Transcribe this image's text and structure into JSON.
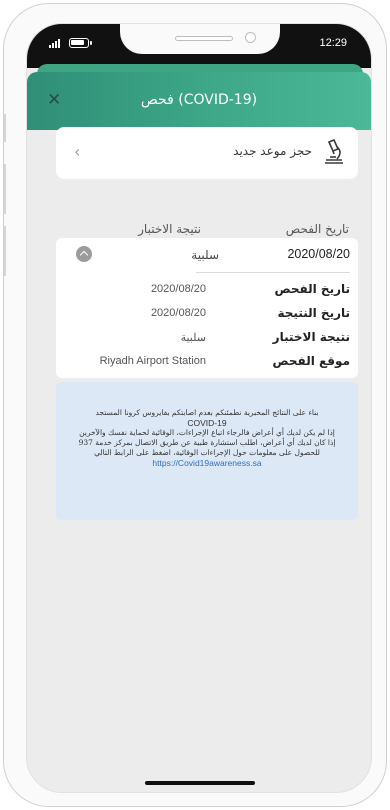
{
  "status_bar": {
    "time": "12:29",
    "signal_icon": "signal-icon",
    "battery_icon": "battery-icon"
  },
  "header": {
    "title": "فحص (COVID-19)",
    "close_icon": "close-icon"
  },
  "book": {
    "label": "حجز موعد جديد",
    "icon": "microscope-icon",
    "chevron": "chevron-left-icon"
  },
  "columns": {
    "date": "تاريخ الفحص",
    "result": "نتيجة الاختبار"
  },
  "summary": {
    "date": "2020/08/20",
    "result": "سلبية"
  },
  "details": [
    {
      "label": "تاريخ الفحص",
      "value": "2020/08/20"
    },
    {
      "label": "تاريخ النتيجة",
      "value": "2020/08/20"
    },
    {
      "label": "نتيجة الاختبار",
      "value": "سلبية"
    },
    {
      "label": "موقع الفحص",
      "value": "Riyadh Airport Station"
    }
  ],
  "info": {
    "line1": "بناء على النتائج المخبرية نطمئنكم بعدم اصابتكم بفايروس كرونا المستجد",
    "line1_en": "COVID-19",
    "line2": "إذا لم يكن لديك أي أعراض فالرجاء اتباع الإجراءات، الوقائية لحماية نفسك والآخرين",
    "line3": "إذا كان لديك أي أعراض، اطلب استشارة طبية عن طريق الاتصال بمركز خدمة 937",
    "line4": "للحصول على معلومات حول الإجراءات الوقائية، اضغط على الرابط التالي",
    "link": "https://Covid19awareness.sa"
  },
  "colors": {
    "header": "#3ea888",
    "info_bg": "#dde8f7",
    "link": "#2d6fbf"
  }
}
